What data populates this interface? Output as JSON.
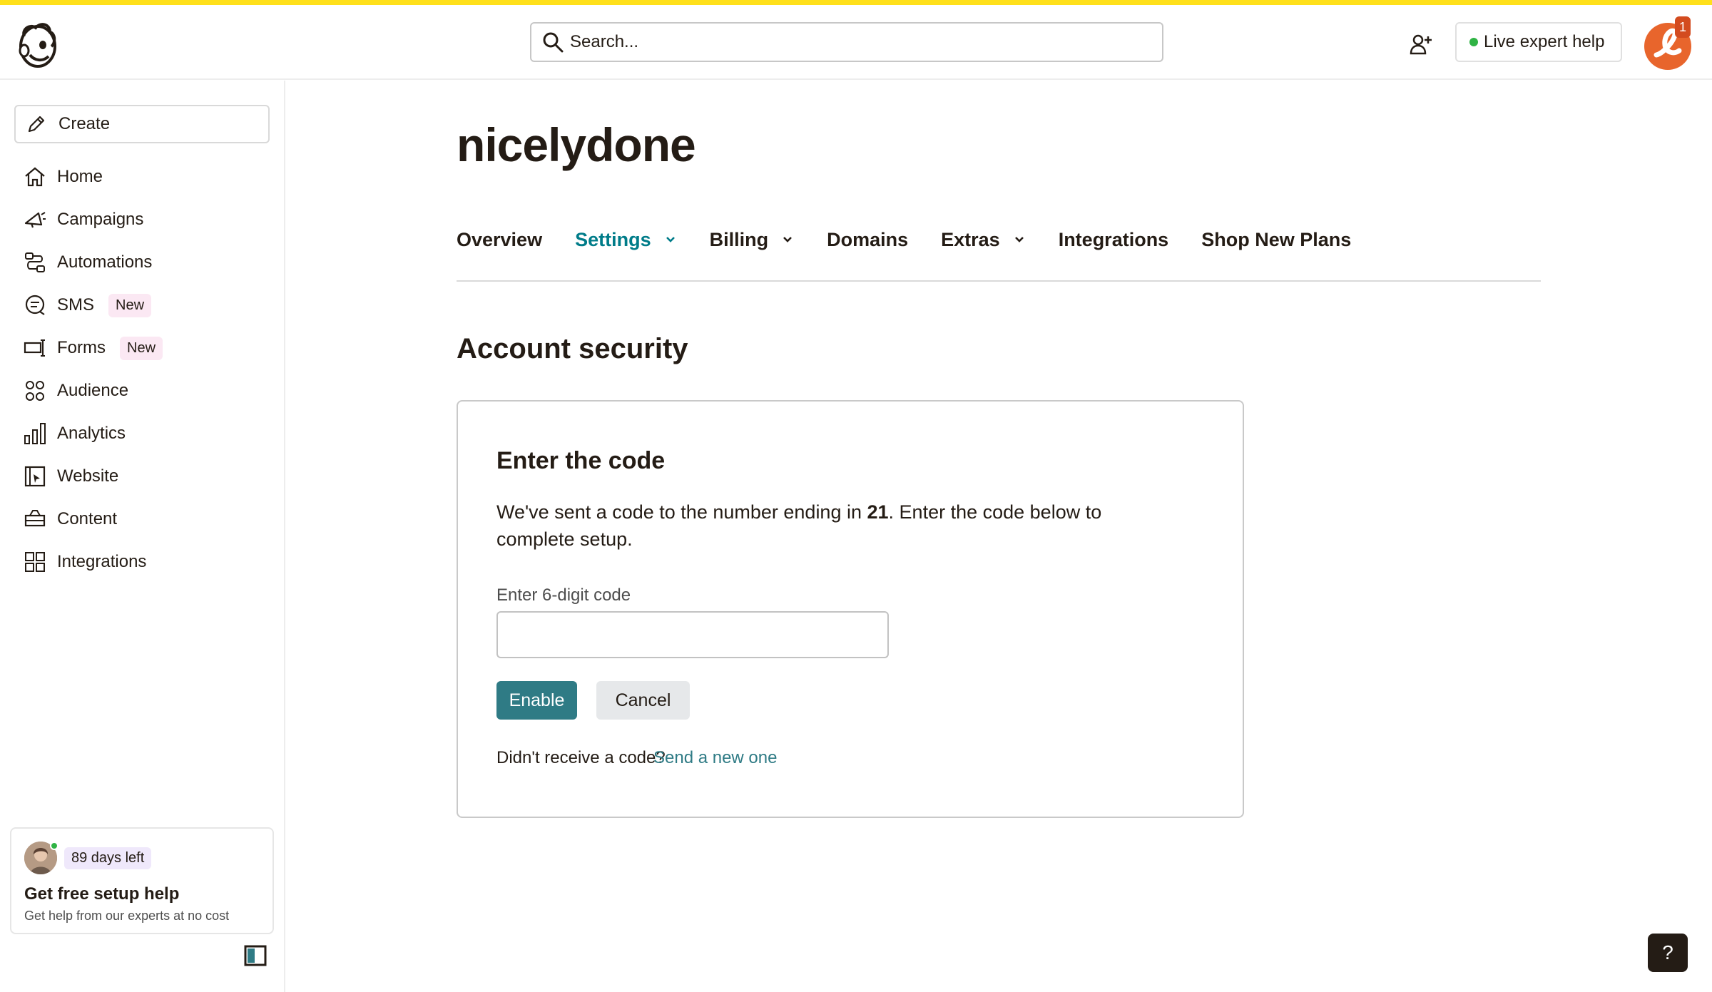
{
  "header": {
    "search_placeholder": "Search...",
    "live_expert_label": "Live expert help",
    "notification_count": "1"
  },
  "sidebar": {
    "create_label": "Create",
    "items": [
      {
        "label": "Home",
        "icon": "home-icon"
      },
      {
        "label": "Campaigns",
        "icon": "megaphone-icon"
      },
      {
        "label": "Automations",
        "icon": "automation-icon"
      },
      {
        "label": "SMS",
        "icon": "chat-icon",
        "badge": "New"
      },
      {
        "label": "Forms",
        "icon": "form-icon",
        "badge": "New"
      },
      {
        "label": "Audience",
        "icon": "audience-icon"
      },
      {
        "label": "Analytics",
        "icon": "bar-chart-icon"
      },
      {
        "label": "Website",
        "icon": "website-icon"
      },
      {
        "label": "Content",
        "icon": "content-icon"
      },
      {
        "label": "Integrations",
        "icon": "grid-icon"
      }
    ],
    "setup_card": {
      "days_left": "89 days left",
      "title": "Get free setup help",
      "subtitle": "Get help from our experts at no cost"
    }
  },
  "main": {
    "account_name": "nicelydone",
    "tabs": [
      {
        "label": "Overview",
        "dropdown": false
      },
      {
        "label": "Settings",
        "dropdown": true,
        "active": true
      },
      {
        "label": "Billing",
        "dropdown": true
      },
      {
        "label": "Domains",
        "dropdown": false
      },
      {
        "label": "Extras",
        "dropdown": true
      },
      {
        "label": "Integrations",
        "dropdown": false
      },
      {
        "label": "Shop New Plans",
        "dropdown": false
      }
    ],
    "section_title": "Account security",
    "card": {
      "title": "Enter the code",
      "desc_before": "We've sent a code to the number ending in ",
      "desc_number": "21",
      "desc_after": ". Enter the code below to complete setup.",
      "field_label": "Enter 6-digit code",
      "field_value": "",
      "enable_label": "Enable",
      "cancel_label": "Cancel",
      "resend_question": "Didn't receive a code?",
      "resend_link": "Send a new one"
    }
  },
  "help_label": "?",
  "colors": {
    "accent": "#007c89",
    "primary_button": "#2f7b85",
    "brand_yellow": "#ffe01b",
    "badge_pink": "#fbe8f3",
    "online_green": "#2fb344"
  }
}
